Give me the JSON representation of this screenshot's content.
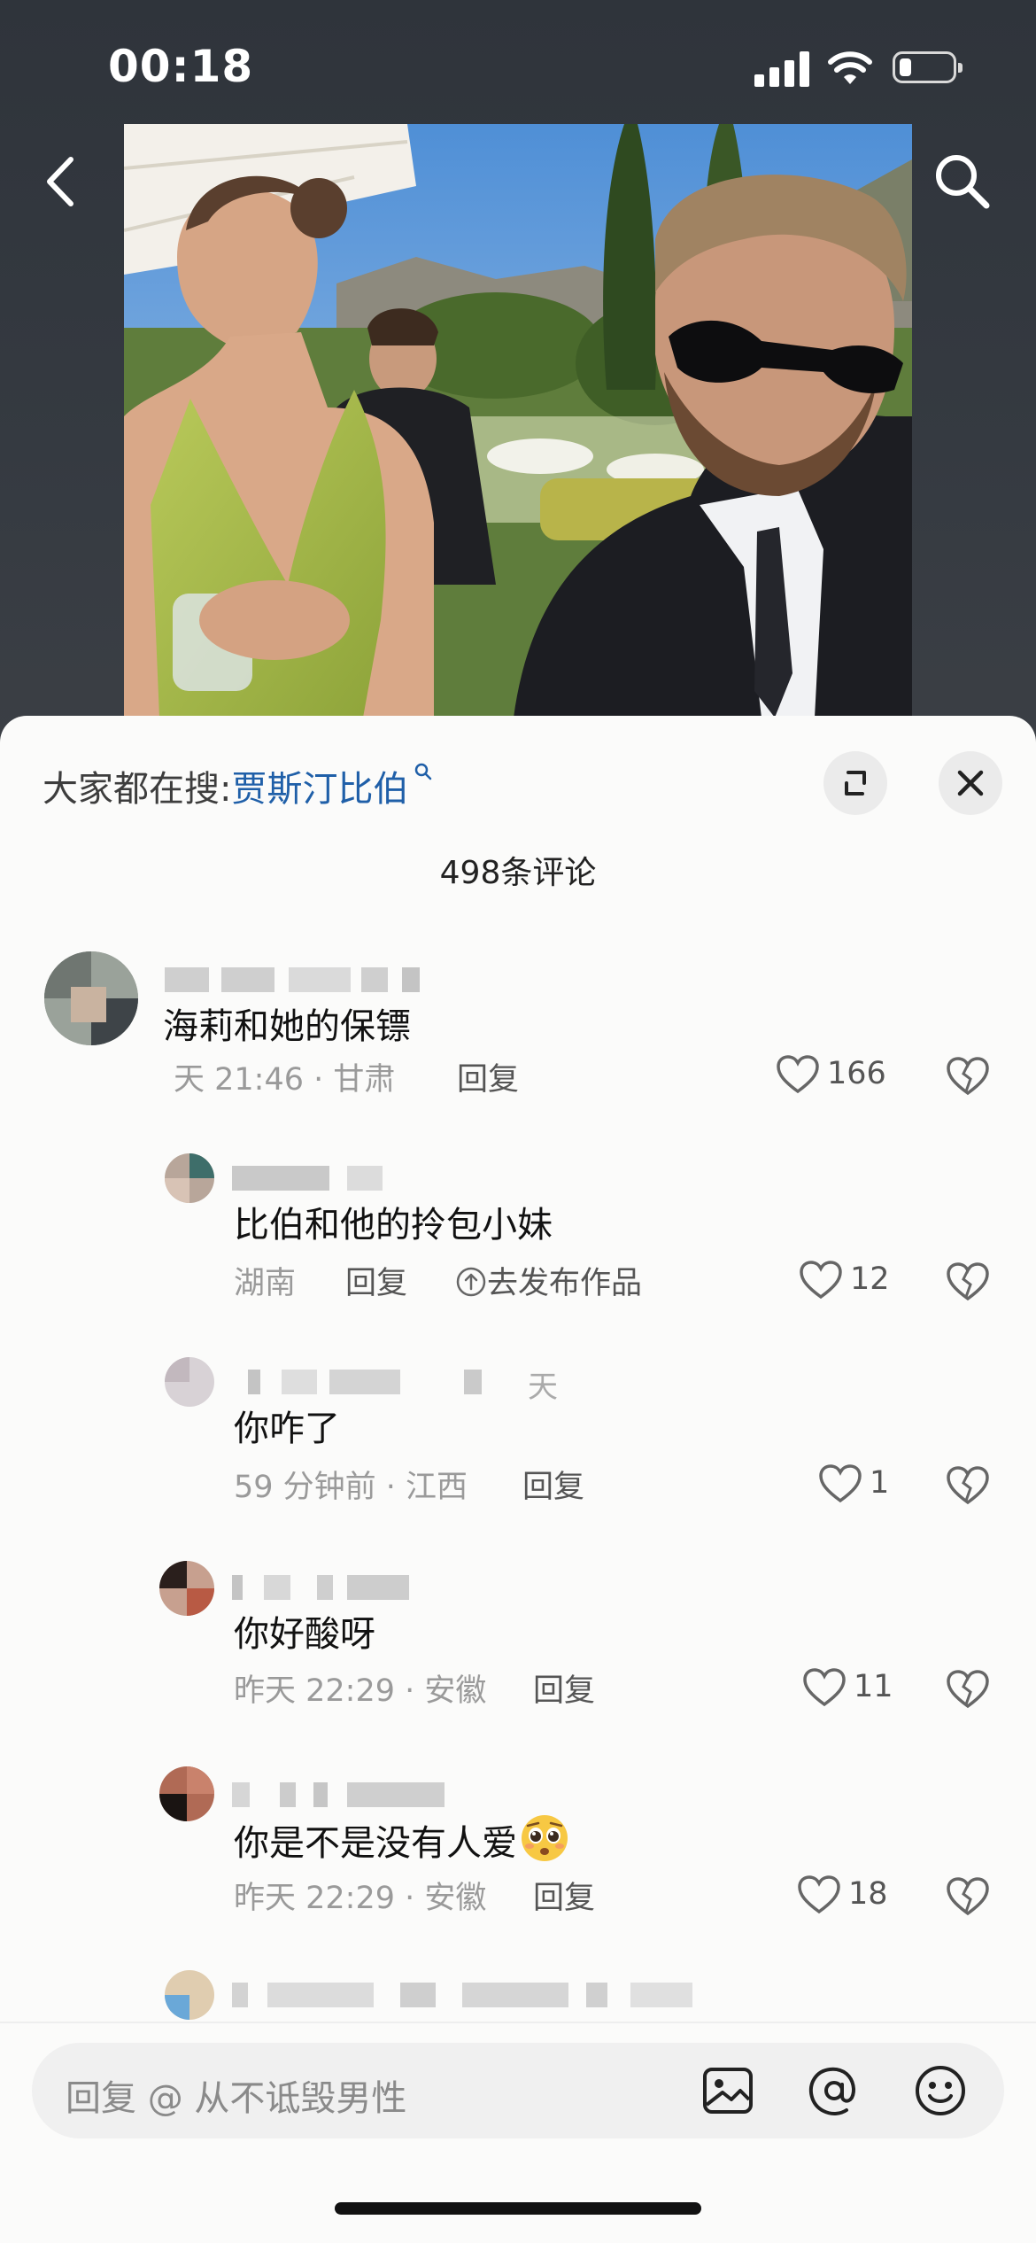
{
  "status_bar": {
    "time": "00:18",
    "battery_level": 0.22
  },
  "trending": {
    "label": "大家都在搜:",
    "keyword": "贾斯汀比伯"
  },
  "comment_count": "498条评论",
  "comments": [
    {
      "text": "海莉和她的保镖",
      "meta": "天 21:46 · 甘肃",
      "reply_label": "回复",
      "likes": "166"
    },
    {
      "text": "比伯和他的拎包小妹",
      "meta": "湖南",
      "reply_label": "回复",
      "post_label": "去发布作品",
      "likes": "12"
    },
    {
      "name_suffix": "天",
      "text": "你咋了",
      "meta": "59 分钟前 · 江西",
      "reply_label": "回复",
      "likes": "1"
    },
    {
      "text": "你好酸呀",
      "meta": "昨天 22:29 · 安徽",
      "reply_label": "回复",
      "likes": "11"
    },
    {
      "text": "你是不是没有人爱",
      "meta": "昨天 22:29 · 安徽",
      "reply_label": "回复",
      "likes": "18"
    }
  ],
  "input": {
    "placeholder": "回复 @ 从不诋毁男性"
  },
  "icons": [
    "back-icon",
    "search-icon",
    "expand-icon",
    "close-icon",
    "heart-icon",
    "broken-heart-icon",
    "image-icon",
    "at-icon",
    "emoji-icon",
    "pleading-face-emoji"
  ],
  "colors": {
    "link_blue": "#1f5fa8",
    "sheet_bg": "#fbfbfa",
    "dim_bg": "#2f343b"
  }
}
